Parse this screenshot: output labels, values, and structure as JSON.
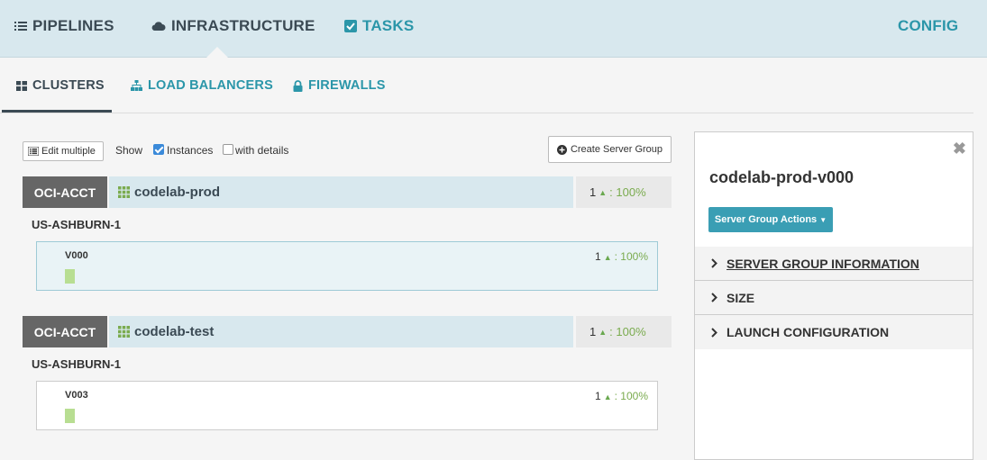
{
  "topnav": {
    "pipelines": "PIPELINES",
    "infrastructure": "INFRASTRUCTURE",
    "tasks": "TASKS",
    "config": "CONFIG"
  },
  "subtabs": {
    "clusters": "CLUSTERS",
    "load_balancers": "LOAD BALANCERS",
    "firewalls": "FIREWALLS"
  },
  "controls": {
    "edit_multiple": "Edit multiple",
    "show": "Show",
    "instances": "Instances",
    "instances_checked": true,
    "with_details": "with details",
    "with_details_checked": false,
    "create_server_group": "Create Server Group"
  },
  "clusters": [
    {
      "account": "OCI-ACCT",
      "name": "codelab-prod",
      "count": "1",
      "health": ": 100%",
      "region": "US-ASHBURN-1",
      "server_group": {
        "name": "V000",
        "count": "1",
        "health": ": 100%",
        "selected": true
      }
    },
    {
      "account": "OCI-ACCT",
      "name": "codelab-test",
      "count": "1",
      "health": ": 100%",
      "region": "US-ASHBURN-1",
      "server_group": {
        "name": "V003",
        "count": "1",
        "health": ": 100%",
        "selected": false
      }
    }
  ],
  "details": {
    "title": "codelab-prod-v000",
    "actions": "Server Group Actions",
    "sections": {
      "info": "SERVER GROUP INFORMATION",
      "size": "SIZE",
      "launch": "LAUNCH CONFIGURATION"
    }
  },
  "colors": {
    "nav_bg": "#d8e8ee",
    "accent": "#2b96a9",
    "account_badge": "#666666",
    "healthy": "#7aab4e",
    "instance_up": "#b8de92",
    "action_button": "#3a9eb4"
  }
}
